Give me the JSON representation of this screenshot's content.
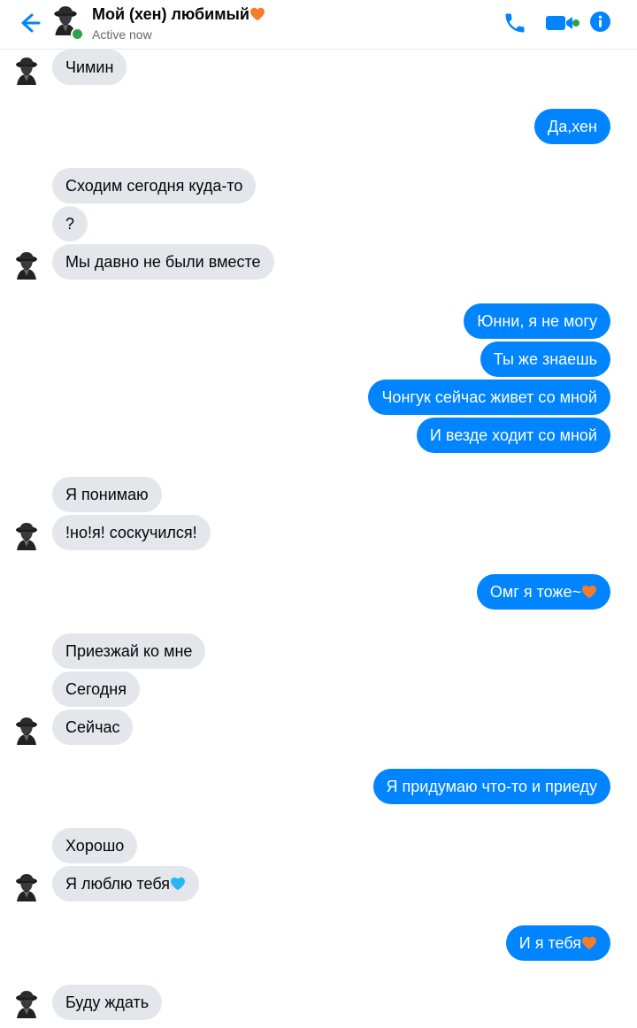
{
  "header": {
    "title": "Мой (хен) любимый",
    "status": "Active now",
    "title_emoji_color": "#f47c2b"
  },
  "colors": {
    "accent": "#0084ff",
    "incoming_bubble": "#e4e6eb",
    "online": "#31a24c",
    "heart_orange": "#f47c2b",
    "heart_blue": "#2ab5f5"
  },
  "messages": [
    {
      "from": "them",
      "text": "Чимин"
    },
    {
      "from": "me",
      "text": "Да,хен"
    },
    {
      "from": "them",
      "text": "Сходим сегодня куда-то"
    },
    {
      "from": "them",
      "text": "?"
    },
    {
      "from": "them",
      "text": "Мы давно не были вместе"
    },
    {
      "from": "me",
      "text": "Юнни, я не могу"
    },
    {
      "from": "me",
      "text": "Ты же знаешь"
    },
    {
      "from": "me",
      "text": "Чонгук сейчас живет со мной"
    },
    {
      "from": "me",
      "text": "И везде ходит со мной"
    },
    {
      "from": "them",
      "text": "Я понимаю"
    },
    {
      "from": "them",
      "text": "!но!я! соскучился!"
    },
    {
      "from": "me",
      "text": "Омг я тоже~",
      "emoji": "orange-heart"
    },
    {
      "from": "them",
      "text": "Приезжай ко мне"
    },
    {
      "from": "them",
      "text": "Сегодня"
    },
    {
      "from": "them",
      "text": "Сейчас"
    },
    {
      "from": "me",
      "text": "Я придумаю что-то  и приеду"
    },
    {
      "from": "them",
      "text": "Хорошо"
    },
    {
      "from": "them",
      "text": "Я люблю тебя",
      "emoji": "blue-heart"
    },
    {
      "from": "me",
      "text": "И я тебя",
      "emoji": "orange-heart"
    },
    {
      "from": "them",
      "text": "Буду ждать"
    }
  ]
}
